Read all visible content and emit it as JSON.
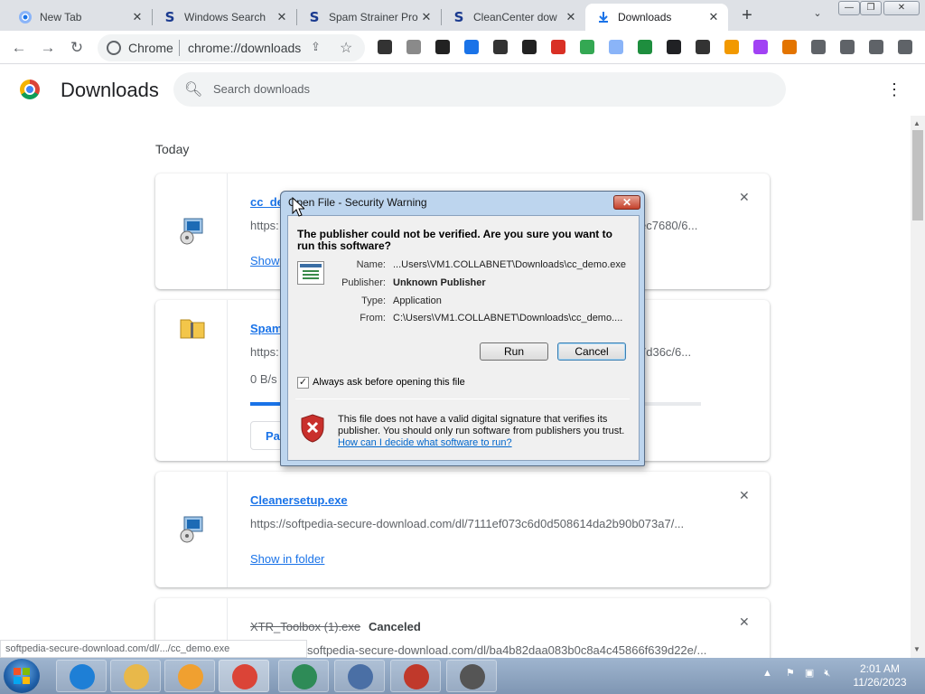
{
  "window": {
    "min_glyph": "—",
    "max_glyph": "❐",
    "close_glyph": "✕"
  },
  "tabs": [
    {
      "label": "New Tab",
      "icon": "chrome-icon",
      "active": false
    },
    {
      "label": "Windows Search",
      "icon": "softpedia-icon",
      "active": false
    },
    {
      "label": "Spam Strainer Pro",
      "icon": "softpedia-icon",
      "active": false
    },
    {
      "label": "CleanCenter dow",
      "icon": "softpedia-icon",
      "active": false
    },
    {
      "label": "Downloads",
      "icon": "download-icon",
      "active": true
    }
  ],
  "tab_close_glyph": "✕",
  "toolbar": {
    "chip": "Chrome",
    "url": "chrome://downloads",
    "new_tab_glyph": "+",
    "tab_search_glyph": "⌄"
  },
  "extensions": [
    {
      "name": "extension-m-icon",
      "color": "#333333"
    },
    {
      "name": "extension-gray-icon",
      "color": "#8a8a8a"
    },
    {
      "name": "extension-shield-icon",
      "color": "#222222"
    },
    {
      "name": "extension-download-icon",
      "color": "#1a73e8"
    },
    {
      "name": "extension-info-icon",
      "color": "#333333"
    },
    {
      "name": "extension-cap-icon",
      "color": "#222222"
    },
    {
      "name": "extension-video-icon",
      "color": "#d93025"
    },
    {
      "name": "extension-cloud-icon",
      "color": "#34a853"
    },
    {
      "name": "extension-heart-icon",
      "color": "#8ab4f8"
    },
    {
      "name": "extension-screenshot-icon",
      "color": "#1e8e3e"
    },
    {
      "name": "extension-edit-icon",
      "color": "#202124"
    },
    {
      "name": "extension-ninja-icon",
      "color": "#333333"
    },
    {
      "name": "extension-pencil-icon",
      "color": "#f29900"
    },
    {
      "name": "extension-avatar-icon",
      "color": "#a142f4"
    },
    {
      "name": "extension-cat-icon",
      "color": "#e37400"
    },
    {
      "name": "extensions-puzzle-icon",
      "color": "#5f6368"
    },
    {
      "name": "side-panel-icon",
      "color": "#5f6368"
    },
    {
      "name": "profile-icon",
      "color": "#5f6368"
    },
    {
      "name": "chrome-menu-icon",
      "color": "#5f6368"
    }
  ],
  "header": {
    "title": "Downloads",
    "search_placeholder": "Search downloads"
  },
  "section_label": "Today",
  "downloads": [
    {
      "file_visible": "cc_de",
      "url_start": "https:",
      "url_end": "ec7680/6...",
      "action": "Show"
    },
    {
      "file_visible": "Spam",
      "url_start": "https:",
      "url_end": "7d36c/6...",
      "speed": "0 B/s",
      "progress": 0.75,
      "action": "Pa"
    },
    {
      "file": "Cleanersetup.exe",
      "url": "https://softpedia-secure-download.com/dl/7111ef073c6d0d508614da2b90b073a7/...",
      "action": "Show in folder"
    },
    {
      "file": "XTR_Toolbox (1).exe",
      "status": "Canceled",
      "url": "softpedia-secure-download.com/dl/ba4b82daa083b0c8a4c45866f639d22e/..."
    }
  ],
  "status_bubble": "softpedia-secure-download.com/dl/.../cc_demo.exe",
  "dialog": {
    "title": "Open File - Security Warning",
    "heading": "The publisher could not be verified.  Are you sure you want to run this software?",
    "fields": [
      {
        "label": "Name:",
        "value": "...Users\\VM1.COLLABNET\\Downloads\\cc_demo.exe",
        "bold": false
      },
      {
        "label": "Publisher:",
        "value": "Unknown Publisher",
        "bold": true
      },
      {
        "label": "Type:",
        "value": "Application",
        "bold": false
      },
      {
        "label": "From:",
        "value": "C:\\Users\\VM1.COLLABNET\\Downloads\\cc_demo....",
        "bold": false
      }
    ],
    "run": "Run",
    "cancel": "Cancel",
    "checkbox_label": "Always ask before opening this file",
    "checkbox_checked": true,
    "warning": "This file does not have a valid digital signature that verifies its publisher.  You should only run software from publishers you trust.",
    "link": "How can I decide what software to run?"
  },
  "taskbar": {
    "apps": [
      {
        "name": "ie-taskbar-button",
        "color": "#1e7fd6"
      },
      {
        "name": "explorer-taskbar-button",
        "color": "#e8b84a"
      },
      {
        "name": "media-taskbar-button",
        "color": "#f0a030"
      },
      {
        "name": "chrome-taskbar-button",
        "color": "#db4437"
      },
      {
        "name": "speedometer-taskbar-button",
        "color": "#2e8b57"
      },
      {
        "name": "cleaner-taskbar-button",
        "color": "#4a6fa5"
      },
      {
        "name": "monitor-taskbar-button",
        "color": "#c0392b"
      },
      {
        "name": "tools-taskbar-button",
        "color": "#555555"
      }
    ],
    "time": "2:01 AM",
    "date": "11/26/2023"
  }
}
